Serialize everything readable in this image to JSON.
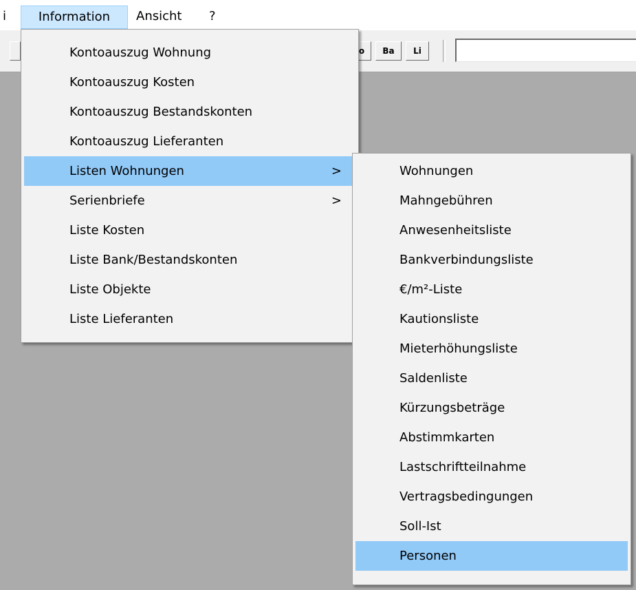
{
  "menubar": {
    "items": [
      {
        "label": "i"
      },
      {
        "label": "Information"
      },
      {
        "label": "Ansicht"
      },
      {
        "label": "?"
      }
    ]
  },
  "toolbar": {
    "buttons": [
      {
        "label": "o"
      },
      {
        "label": "Ba"
      },
      {
        "label": "Li"
      }
    ],
    "input_value": ""
  },
  "information_menu": {
    "items": [
      {
        "label": "Kontoauszug Wohnung"
      },
      {
        "label": "Kontoauszug Kosten"
      },
      {
        "label": "Kontoauszug Bestandskonten"
      },
      {
        "label": "Kontoauszug Lieferanten"
      },
      {
        "label": "Listen Wohnungen",
        "submenu_arrow": ">",
        "highlighted": true
      },
      {
        "label": "Serienbriefe",
        "submenu_arrow": ">"
      },
      {
        "label": "Liste Kosten"
      },
      {
        "label": "Liste Bank/Bestandskonten"
      },
      {
        "label": "Liste Objekte"
      },
      {
        "label": "Liste Lieferanten"
      }
    ]
  },
  "listen_wohnungen_submenu": {
    "items": [
      {
        "label": "Wohnungen"
      },
      {
        "label": "Mahngebühren"
      },
      {
        "label": "Anwesenheitsliste"
      },
      {
        "label": "Bankverbindungsliste"
      },
      {
        "label": "€/m²-Liste"
      },
      {
        "label": "Kautionsliste"
      },
      {
        "label": "Mieterhöhungsliste"
      },
      {
        "label": "Saldenliste"
      },
      {
        "label": "Kürzungsbeträge"
      },
      {
        "label": "Abstimmkarten"
      },
      {
        "label": "Lastschriftteilnahme"
      },
      {
        "label": "Vertragsbedingungen"
      },
      {
        "label": "Soll-Ist"
      },
      {
        "label": "Personen",
        "highlighted": true
      }
    ]
  },
  "colors": {
    "workspace": "#ababab",
    "menu_background": "#f2f2f2",
    "highlight": "#91c9f7",
    "menubar_active": "#cce8ff"
  }
}
